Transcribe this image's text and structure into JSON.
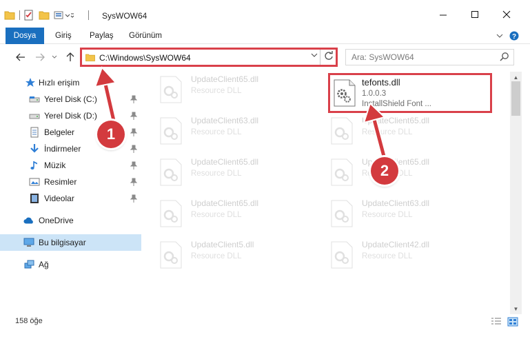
{
  "window": {
    "title": "SysWOW64"
  },
  "ribbon": {
    "file_tab": "Dosya",
    "tabs": [
      "Giriş",
      "Paylaş",
      "Görünüm"
    ]
  },
  "address": {
    "path": "C:\\Windows\\SysWOW64"
  },
  "search": {
    "placeholder": "Ara: SysWOW64"
  },
  "sidebar": {
    "quick_access": "Hızlı erişim",
    "items": [
      "Yerel Disk (C:)",
      "Yerel Disk (D:)",
      "Belgeler",
      "İndirmeler",
      "Müzik",
      "Resimler",
      "Videolar"
    ],
    "onedrive": "OneDrive",
    "this_pc": "Bu bilgisayar",
    "network": "Ağ"
  },
  "files": {
    "highlighted": {
      "name": "tefonts.dll",
      "version": "1.0.0.3",
      "company": "InstallShield Font ..."
    },
    "left_column": [
      {
        "name": "UpdateClient65.dll",
        "type": "Resource DLL"
      },
      {
        "name": "UpdateClient63.dll",
        "type": "Resource DLL"
      },
      {
        "name": "UpdateClient65.dll",
        "type": "Resource DLL"
      },
      {
        "name": "UpdateClient65.dll",
        "type": "Resource DLL"
      },
      {
        "name": "UpdateClient5.dll",
        "type": "Resource DLL"
      }
    ],
    "right_column": [
      {
        "name": "UpdateClient65.dll",
        "type": "Resource DLL"
      },
      {
        "name": "UpdateClient65.dll",
        "type": "Resource DLL"
      },
      {
        "name": "UpdateClient63.dll",
        "type": "Resource DLL"
      },
      {
        "name": "UpdateClient42.dll",
        "type": "Resource DLL"
      }
    ]
  },
  "status": {
    "item_count": "158 öğe"
  },
  "callouts": {
    "step1": "1",
    "step2": "2"
  },
  "colors": {
    "accent": "#1a6fbf",
    "highlight_red": "#d9404a",
    "badge_red": "#d33a3e",
    "selection": "#cce4f7"
  }
}
